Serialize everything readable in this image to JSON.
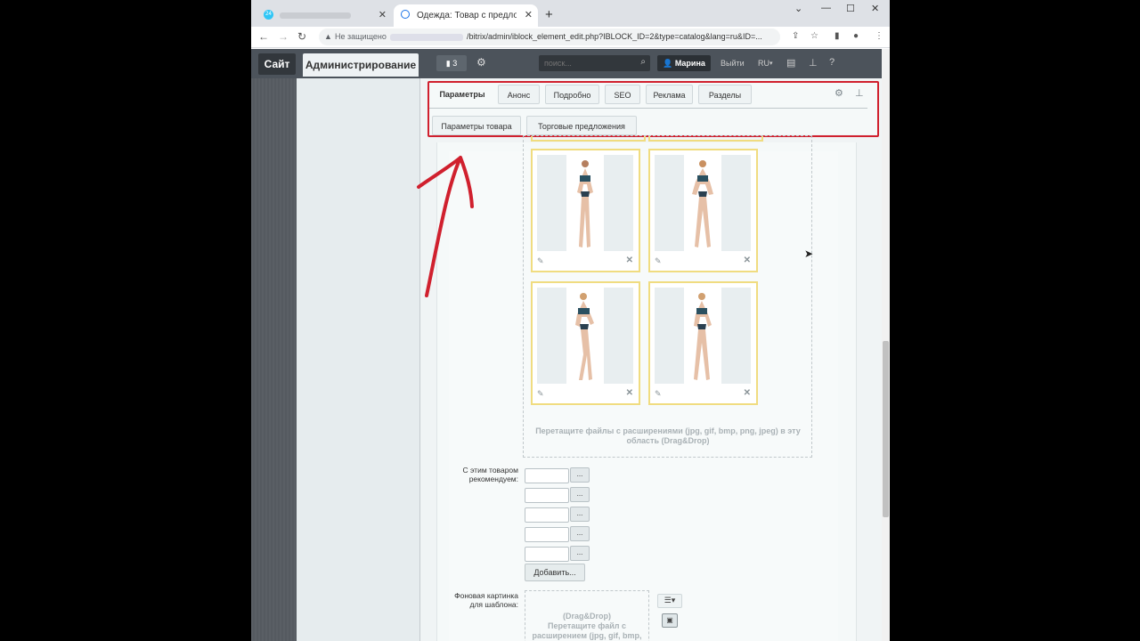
{
  "browser": {
    "tabs": [
      {
        "title": "",
        "favicon": "24"
      },
      {
        "title": "Одежда: Товар с предложения"
      }
    ],
    "new_tab": "+",
    "address": {
      "security_label": "Не защищено",
      "url": "/bitrix/admin/iblock_element_edit.php?IBLOCK_ID=2&type=catalog&lang=ru&ID=..."
    }
  },
  "admin_bar": {
    "site_label": "Сайт",
    "admin_label": "Администрирование",
    "notifications_count": "3",
    "search_placeholder": "поиск...",
    "user_name": "Марина",
    "logout_label": "Выйти",
    "lang_label": "RU"
  },
  "tabs": {
    "items": [
      "Параметры",
      "Анонс",
      "Подробно",
      "SEO",
      "Реклама",
      "Разделы"
    ],
    "active": "Параметры",
    "sub_items": [
      "Параметры товара",
      "Торговые предложения"
    ]
  },
  "gallery": {
    "images": [
      {
        "name": "model-photo-1"
      },
      {
        "name": "model-photo-2"
      },
      {
        "name": "model-photo-3"
      },
      {
        "name": "model-photo-4"
      }
    ],
    "drop_text": "Перетащите файлы с расширениями (jpg, gif, bmp, png, jpeg) в эту область (Drag&Drop)"
  },
  "recommend": {
    "label": "С этим товаром рекомендуем:",
    "inputs": [
      "",
      "",
      "",
      "",
      ""
    ],
    "picker_label": "...",
    "add_label": "Добавить..."
  },
  "bg_image": {
    "label": "Фоновая картинка для шаблона:",
    "drop_title": "(Drag&Drop)",
    "drop_text": "Перетащите файл с расширением (jpg, gif, bmp,"
  },
  "colors": {
    "highlight_red": "#d0202e",
    "card_border": "#f0dc80",
    "admin_header": "#4c535b"
  }
}
